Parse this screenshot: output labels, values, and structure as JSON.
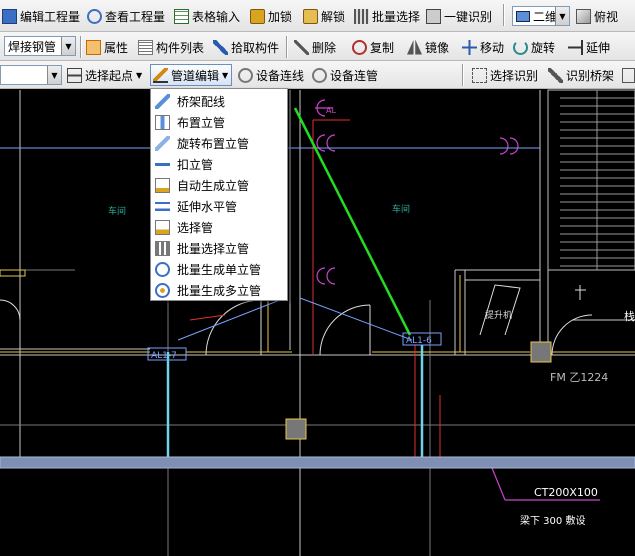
{
  "toolbar1": {
    "edit_quantity": "编辑工程量",
    "view_quantity": "查看工程量",
    "table_input": "表格输入",
    "lock": "加锁",
    "unlock": "解锁",
    "batch_select": "批量选择",
    "one_click_identify": "一键识别",
    "view_mode": "二维",
    "view_direction": "俯视"
  },
  "toolbar2": {
    "pipe_type": "焊接钢管",
    "properties": "属性",
    "component_list": "构件列表",
    "pick_component": "拾取构件",
    "delete": "删除",
    "copy": "复制",
    "mirror": "镜像",
    "move": "移动",
    "rotate": "旋转",
    "extend": "延伸"
  },
  "toolbar3": {
    "blank_combo": "",
    "select_start": "选择起点",
    "pipe_edit": "管道编辑",
    "device_connect_line": "设备连线",
    "device_connect_pipe": "设备连管",
    "select_identify": "选择识别",
    "identify_tray": "识别桥架"
  },
  "pipe_edit_menu": [
    {
      "label": "桥架配线",
      "icon": "tray-wiring-icon"
    },
    {
      "label": "布置立管",
      "icon": "place-riser-icon"
    },
    {
      "label": "旋转布置立管",
      "icon": "rotate-riser-icon"
    },
    {
      "label": "扣立管",
      "icon": "buckle-riser-icon"
    },
    {
      "label": "自动生成立管",
      "icon": "auto-riser-icon"
    },
    {
      "label": "延伸水平管",
      "icon": "extend-horizontal-icon"
    },
    {
      "label": "选择管",
      "icon": "select-pipe-icon"
    },
    {
      "label": "批量选择立管",
      "icon": "batch-select-riser-icon"
    },
    {
      "label": "批量生成单立管",
      "icon": "batch-single-riser-icon"
    },
    {
      "label": "批量生成多立管",
      "icon": "batch-multi-riser-icon"
    }
  ],
  "drawing": {
    "room_left": "车间",
    "room_right": "车间",
    "elevator": "提升机",
    "door_code": "FM 乙1224",
    "tag_left": "AL1-7",
    "tag_right": "AL1-6",
    "tag_top": "AL",
    "tray_size": "CT200X100",
    "tray_note": "梁下 300 敷设",
    "edge_text": "栈"
  },
  "colors": {
    "background": "#000000",
    "tray": "#7f8fb4",
    "pipe": "#6fd4e6",
    "diagonal": "#22dd22",
    "wall": "#c8c8c8",
    "beam": "#e6c84a",
    "annotation": "#cc44cc"
  }
}
